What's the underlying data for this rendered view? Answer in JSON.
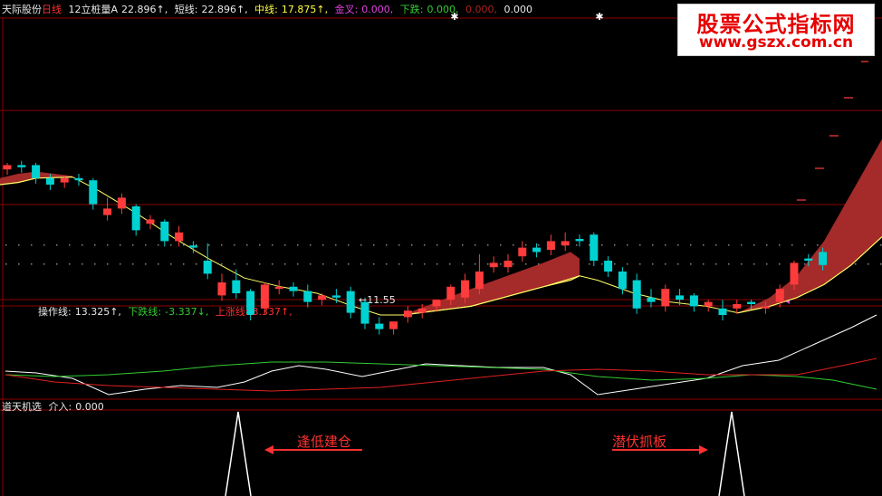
{
  "main_header": {
    "stock_name": "天际股份",
    "period": "日线",
    "indicator": "12立桩量A",
    "indicator_value": "22.896↑,",
    "short_label": "短线:",
    "short_value": "22.896↑,",
    "mid_label": "中线:",
    "mid_value": "17.875↑,",
    "gold_label": "金叉:",
    "gold_value": "0.000,",
    "drop_label": "下跌:",
    "drop_value": "0.000,",
    "extra1": "0.000,",
    "extra2": "0.000"
  },
  "low_price_label": "11.55",
  "panel2_header": {
    "op_label": "操作线:",
    "op_value": "13.325↑,",
    "down_label": "下跌线:",
    "down_value": "-3.337↓,",
    "up_label": "上涨线:",
    "up_value": "3.337↑,"
  },
  "panel3_header": {
    "title": "道天机选",
    "entry_label": "介入:",
    "entry_value": "0.000"
  },
  "annotations": {
    "left": "逢低建仓",
    "right": "潜伏抓板"
  },
  "watermark": {
    "line1": "股票公式指标网",
    "line2": "www.gszx.com.cn"
  },
  "colors": {
    "up": "#ff3b3b",
    "down": "#00d2d2",
    "band": "#a52a2a",
    "ma": "#ffff66",
    "white_line": "#ffffff",
    "green_line": "#33cc33",
    "red_line": "#e02020",
    "grid": "#8b0000"
  },
  "chart_data": {
    "type": "candlestick",
    "candles": [
      {
        "o": 18.9,
        "h": 19.2,
        "c": 19.1
      },
      {
        "o": 19.1,
        "h": 19.3,
        "c": 19.0
      },
      {
        "o": 19.1,
        "h": 19.2,
        "c": 18.5
      },
      {
        "o": 18.5,
        "h": 18.7,
        "c": 18.2
      },
      {
        "o": 18.3,
        "h": 18.6,
        "c": 18.5
      },
      {
        "o": 18.5,
        "h": 18.7,
        "c": 18.4
      },
      {
        "o": 18.4,
        "h": 18.5,
        "c": 17.3
      },
      {
        "o": 16.8,
        "h": 17.6,
        "c": 17.1
      },
      {
        "o": 17.1,
        "h": 17.8,
        "c": 17.6
      },
      {
        "o": 17.2,
        "h": 17.3,
        "c": 16.1
      },
      {
        "o": 16.4,
        "h": 16.8,
        "c": 16.6
      },
      {
        "o": 16.5,
        "h": 16.6,
        "c": 15.6
      },
      {
        "o": 15.6,
        "h": 16.3,
        "c": 16.0
      },
      {
        "o": 15.4,
        "h": 15.6,
        "c": 15.3
      },
      {
        "o": 14.7,
        "h": 15.5,
        "c": 14.1
      },
      {
        "o": 13.1,
        "h": 14.1,
        "c": 13.7
      },
      {
        "o": 13.8,
        "h": 14.3,
        "c": 13.2
      },
      {
        "o": 13.3,
        "h": 13.4,
        "c": 12.2
      },
      {
        "o": 12.5,
        "h": 13.7,
        "c": 13.6
      },
      {
        "o": 13.4,
        "h": 13.8,
        "c": 13.5
      },
      {
        "o": 13.5,
        "h": 13.7,
        "c": 13.3
      },
      {
        "o": 13.3,
        "h": 13.6,
        "c": 12.8
      },
      {
        "o": 12.9,
        "h": 13.2,
        "c": 13.1
      },
      {
        "o": 13.1,
        "h": 13.4,
        "c": 13.0
      },
      {
        "o": 13.3,
        "h": 13.5,
        "c": 12.3
      },
      {
        "o": 12.8,
        "h": 13.0,
        "c": 11.8
      },
      {
        "o": 11.8,
        "h": 12.1,
        "c": 11.55
      },
      {
        "o": 11.55,
        "h": 11.9,
        "c": 11.9
      },
      {
        "o": 12.1,
        "h": 12.6,
        "c": 12.4
      },
      {
        "o": 12.3,
        "h": 12.7,
        "c": 12.5
      },
      {
        "o": 12.6,
        "h": 12.9,
        "c": 12.9
      },
      {
        "o": 12.9,
        "h": 13.6,
        "c": 13.5
      },
      {
        "o": 13.0,
        "h": 14.1,
        "c": 13.8
      },
      {
        "o": 13.4,
        "h": 15.0,
        "c": 14.2
      },
      {
        "o": 14.4,
        "h": 14.9,
        "c": 14.6
      },
      {
        "o": 14.4,
        "h": 15.0,
        "c": 14.7
      },
      {
        "o": 14.9,
        "h": 15.6,
        "c": 15.3
      },
      {
        "o": 15.3,
        "h": 15.5,
        "c": 15.1
      },
      {
        "o": 15.2,
        "h": 15.9,
        "c": 15.6
      },
      {
        "o": 15.4,
        "h": 16.0,
        "c": 15.6
      },
      {
        "o": 15.7,
        "h": 15.9,
        "c": 15.6
      },
      {
        "o": 15.9,
        "h": 16.0,
        "c": 14.7
      },
      {
        "o": 14.7,
        "h": 14.9,
        "c": 14.2
      },
      {
        "o": 14.2,
        "h": 14.4,
        "c": 13.4
      },
      {
        "o": 13.8,
        "h": 14.1,
        "c": 12.5
      },
      {
        "o": 13.0,
        "h": 13.4,
        "c": 12.8
      },
      {
        "o": 12.6,
        "h": 13.6,
        "c": 13.4
      },
      {
        "o": 13.1,
        "h": 13.4,
        "c": 12.9
      },
      {
        "o": 13.1,
        "h": 13.2,
        "c": 12.6
      },
      {
        "o": 12.6,
        "h": 12.9,
        "c": 12.8
      },
      {
        "o": 12.5,
        "h": 12.9,
        "c": 12.2
      },
      {
        "o": 12.5,
        "h": 12.9,
        "c": 12.7
      },
      {
        "o": 12.8,
        "h": 12.9,
        "c": 12.7
      },
      {
        "o": 12.5,
        "h": 12.8,
        "c": 12.6
      },
      {
        "o": 12.8,
        "h": 13.6,
        "c": 13.4
      },
      {
        "o": 13.6,
        "h": 14.7,
        "c": 14.6
      },
      {
        "o": 14.8,
        "h": 15.0,
        "c": 14.7
      },
      {
        "o": 15.1,
        "h": 15.3,
        "c": 14.5
      }
    ],
    "target_markers": [
      21.5,
      22.0,
      22.4,
      22.9
    ]
  }
}
